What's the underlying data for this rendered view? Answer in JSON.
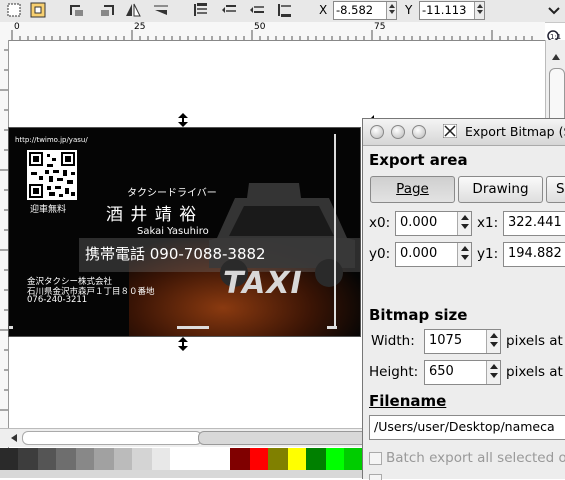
{
  "toolbar": {
    "x_label": "X",
    "x_value": "-8.582",
    "y_label": "Y",
    "y_value": "-11.113"
  },
  "ruler": {
    "marks": [
      "0",
      "25",
      "50",
      "75"
    ]
  },
  "card": {
    "url": "http://twimo.jp/yasu/",
    "free_pickup": "迎車無料",
    "job_title": "タクシードライバー",
    "name_kanji": "酒 井 靖 裕",
    "name_romaji": "Sakai Yasuhiro",
    "phone": "携帯電話 090-7088-3882",
    "company": "金沢タクシー株式会社",
    "address": "石川県金沢市森戸１丁目８０番地",
    "tel": "076-240-3211",
    "taxi_sign": "TAXI"
  },
  "dialog": {
    "title": "Export Bitmap (S",
    "export_area": "Export area",
    "tabs": [
      "Page",
      "Drawing",
      "S"
    ],
    "x0_label": "x0:",
    "x0_value": "0.000",
    "x1_label": "x1:",
    "x1_value": "322.441",
    "y0_label": "y0:",
    "y0_value": "0.000",
    "y1_label": "y1:",
    "y1_value": "194.882",
    "bitmap_size": "Bitmap size",
    "width_label": "Width:",
    "width_value": "1075",
    "height_label": "Height:",
    "height_value": "650",
    "pixels_at": "pixels at",
    "filename_heading": "Filename",
    "filename_value": "/Users/user/Desktop/nameca",
    "batch_export": "Batch export all selected o"
  },
  "palette": [
    "#2a2a2a",
    "#3d3d3d",
    "#555555",
    "#6e6e6e",
    "#888888",
    "#a1a1a1",
    "#bbbbbb",
    "#d4d4d4",
    "#e8e8e8",
    "#ffffff",
    "#800000",
    "#ff0000",
    "#808000",
    "#ffff00",
    "#008000",
    "#00ff00",
    "#00cc00"
  ]
}
